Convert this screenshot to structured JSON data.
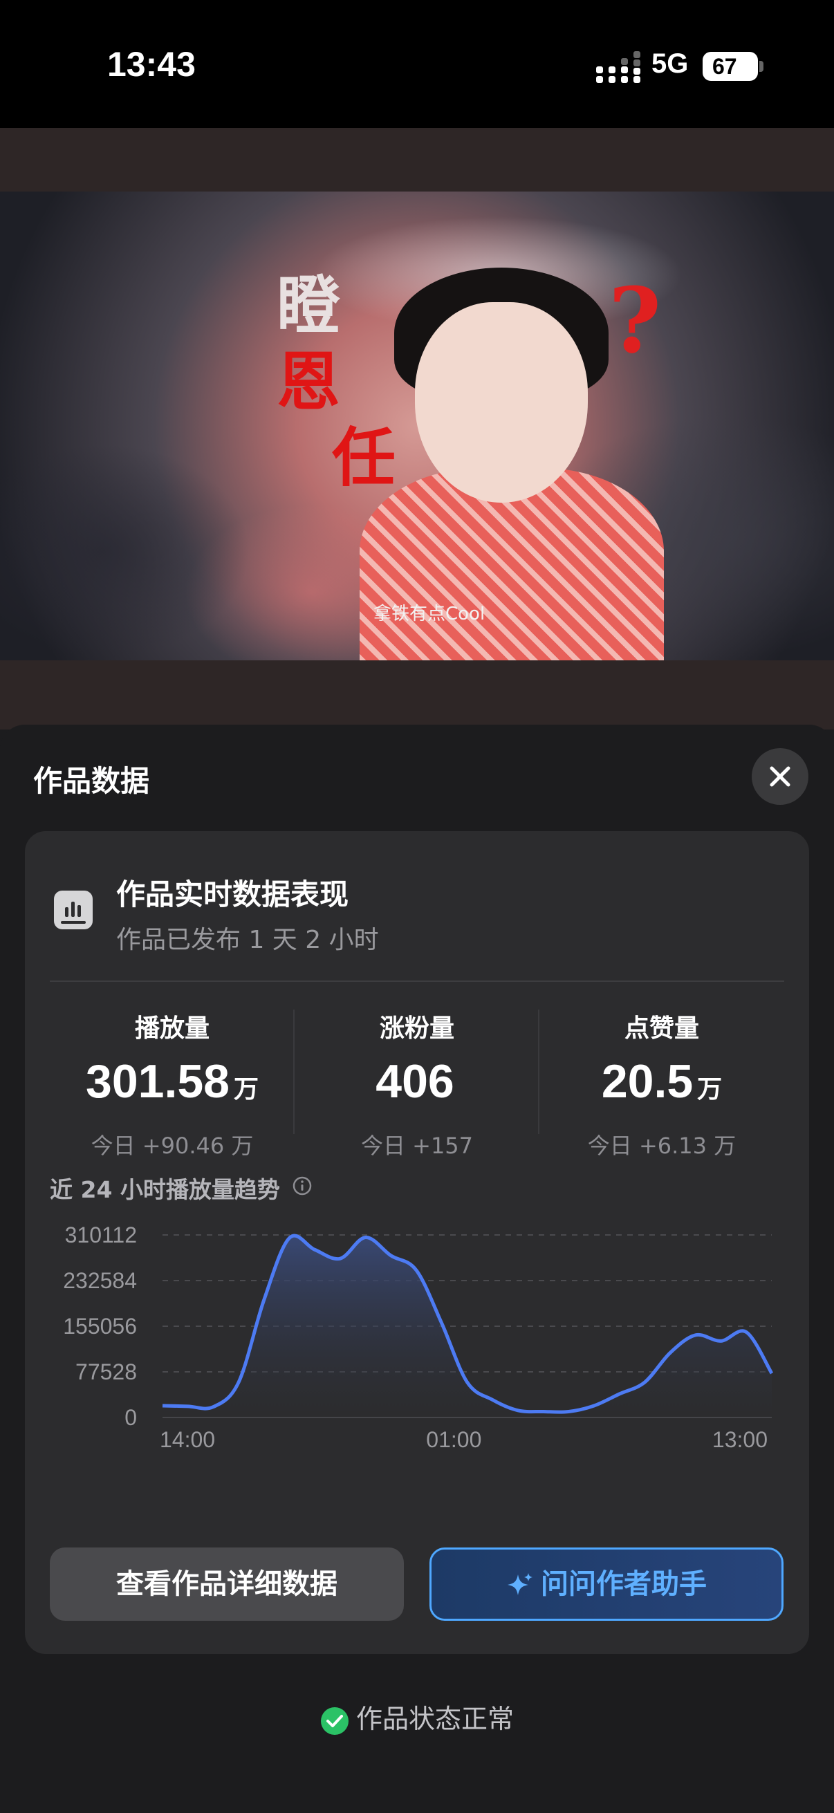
{
  "status_bar": {
    "time": "13:43",
    "network": "5G",
    "battery": "67"
  },
  "thumbnail": {
    "overlay_chars": [
      "瞪",
      "恩",
      "任"
    ],
    "question_mark": "?",
    "watermark": "拿铁有点Cool"
  },
  "sheet": {
    "title": "作品数据"
  },
  "card": {
    "title": "作品实时数据表现",
    "subtitle": "作品已发布 1 天 2 小时"
  },
  "metrics": [
    {
      "label": "播放量",
      "value": "301.58",
      "unit": "万",
      "today": "今日 +90.46 万"
    },
    {
      "label": "涨粉量",
      "value": "406",
      "unit": "",
      "today": "今日 +157"
    },
    {
      "label": "点赞量",
      "value": "20.5",
      "unit": "万",
      "today": "今日 +6.13 万"
    }
  ],
  "trend": {
    "title": "近 24 小时播放量趋势"
  },
  "chart_data": {
    "type": "area",
    "title": "近 24 小时播放量趋势",
    "xlabel": "",
    "ylabel": "",
    "y_ticks": [
      0,
      77528,
      155056,
      232584,
      310112
    ],
    "y_tick_labels": [
      "0",
      "77528",
      "155056",
      "232584",
      "310112"
    ],
    "ylim": [
      0,
      310112
    ],
    "x_tick_labels": [
      "14:00",
      "01:00",
      "13:00"
    ],
    "x_tick_index": [
      0,
      11,
      23
    ],
    "grid": true,
    "colors": {
      "line": "#4d7bf3",
      "fill": "#2f3b5e"
    },
    "series": [
      {
        "values": [
          20000,
          19000,
          18000,
          60000,
          200000,
          305000,
          285000,
          270000,
          306000,
          275000,
          250000,
          160000,
          60000,
          30000,
          12000,
          10000,
          10000,
          20000,
          40000,
          60000,
          110000,
          140000,
          130000,
          145000,
          75000
        ]
      }
    ]
  },
  "buttons": {
    "detail": "查看作品详细数据",
    "ask": "问问作者助手"
  },
  "footer": {
    "status": "作品状态正常"
  }
}
